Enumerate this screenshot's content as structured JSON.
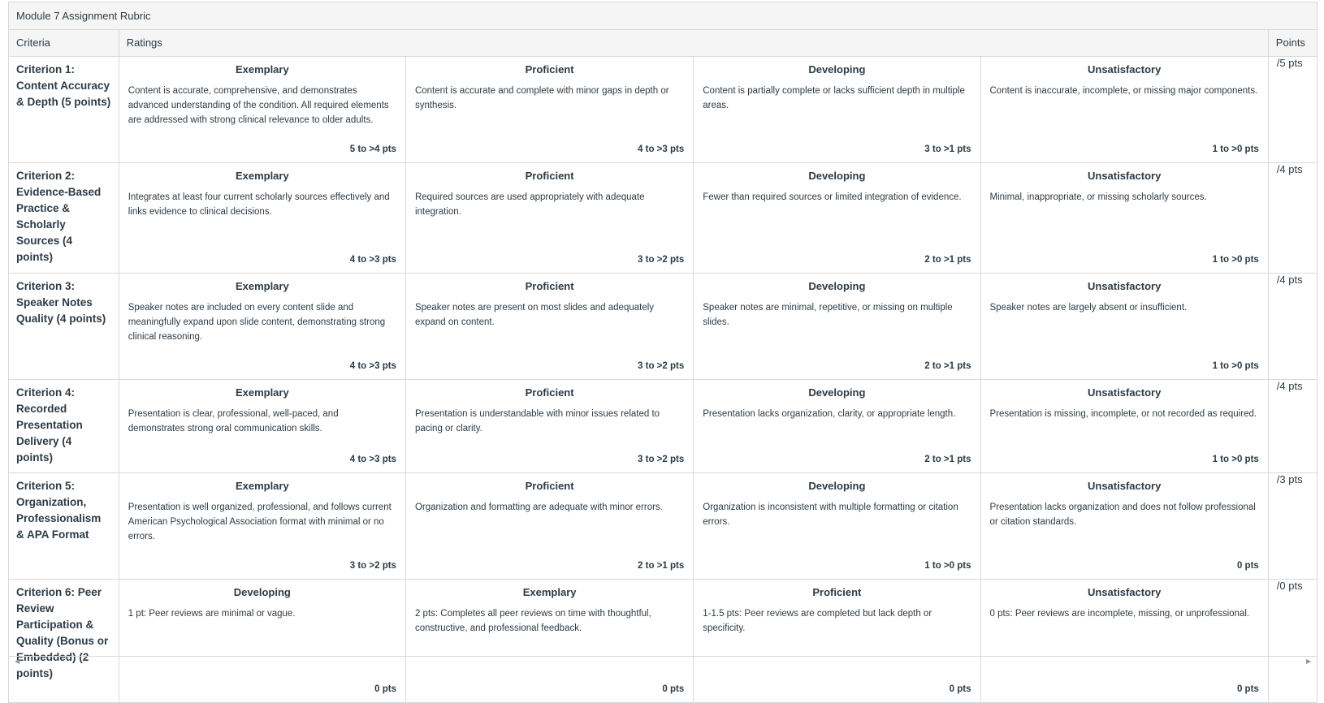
{
  "title": "Module 7 Assignment Rubric",
  "headers": {
    "criteria": "Criteria",
    "ratings": "Ratings",
    "points": "Points"
  },
  "rows": [
    {
      "criterion": "Criterion 1: Content Accuracy & Depth (5 points)",
      "ratings": [
        {
          "title": "Exemplary",
          "desc": "Content is accurate, comprehensive, and demonstrates advanced understanding of the condition. All required elements are addressed with strong clinical relevance to older adults.",
          "pts": "5 to >4 pts"
        },
        {
          "title": "Proficient",
          "desc": "Content is accurate and complete with minor gaps in depth or synthesis.",
          "pts": "4 to >3 pts"
        },
        {
          "title": "Developing",
          "desc": "Content is partially complete or lacks sufficient depth in multiple areas.",
          "pts": "3 to >1 pts"
        },
        {
          "title": "Unsatisfactory",
          "desc": "Content is inaccurate, incomplete, or missing major components.",
          "pts": "1 to >0 pts"
        }
      ],
      "points": "/5 pts"
    },
    {
      "criterion": "Criterion 2: Evidence-Based Practice & Scholarly Sources (4 points)",
      "ratings": [
        {
          "title": "Exemplary",
          "desc": "Integrates at least four current scholarly sources effectively and links evidence to clinical decisions.",
          "pts": "4 to >3 pts"
        },
        {
          "title": "Proficient",
          "desc": "Required sources are used appropriately with adequate integration.",
          "pts": "3 to >2 pts"
        },
        {
          "title": "Developing",
          "desc": "Fewer than required sources or limited integration of evidence.",
          "pts": "2 to >1 pts"
        },
        {
          "title": "Unsatisfactory",
          "desc": "Minimal, inappropriate, or missing scholarly sources.",
          "pts": "1 to >0 pts"
        }
      ],
      "points": "/4 pts"
    },
    {
      "criterion": "Criterion 3: Speaker Notes Quality (4 points)",
      "ratings": [
        {
          "title": "Exemplary",
          "desc": "Speaker notes are included on every content slide and meaningfully expand upon slide content, demonstrating strong clinical reasoning.",
          "pts": "4 to >3 pts"
        },
        {
          "title": "Proficient",
          "desc": "Speaker notes are present on most slides and adequately expand on content.",
          "pts": "3 to >2 pts"
        },
        {
          "title": "Developing",
          "desc": "Speaker notes are minimal, repetitive, or missing on multiple slides.",
          "pts": "2 to >1 pts"
        },
        {
          "title": "Unsatisfactory",
          "desc": "Speaker notes are largely absent or insufficient.",
          "pts": "1 to >0 pts"
        }
      ],
      "points": "/4 pts"
    },
    {
      "criterion": "Criterion 4: Recorded Presentation Delivery (4 points)",
      "ratings": [
        {
          "title": "Exemplary",
          "desc": "Presentation is clear, professional, well-paced, and demonstrates strong oral communication skills.",
          "pts": "4 to >3 pts"
        },
        {
          "title": "Proficient",
          "desc": "Presentation is understandable with minor issues related to pacing or clarity.",
          "pts": "3 to >2 pts"
        },
        {
          "title": "Developing",
          "desc": "Presentation lacks organization, clarity, or appropriate length.",
          "pts": "2 to >1 pts"
        },
        {
          "title": "Unsatisfactory",
          "desc": "Presentation is missing, incomplete, or not recorded as required.",
          "pts": "1 to >0 pts"
        }
      ],
      "points": "/4 pts"
    },
    {
      "criterion": "Criterion 5: Organization, Professionalism & APA Format",
      "ratings": [
        {
          "title": "Exemplary",
          "desc": "Presentation is well organized, professional, and follows current American Psychological Association format with minimal or no errors.",
          "pts": "3 to >2 pts"
        },
        {
          "title": "Proficient",
          "desc": "Organization and formatting are adequate with minor errors.",
          "pts": "2 to >1 pts"
        },
        {
          "title": "Developing",
          "desc": "Organization is inconsistent with multiple formatting or citation errors.",
          "pts": "1 to >0 pts"
        },
        {
          "title": "Unsatisfactory",
          "desc": "Presentation lacks organization and does not follow professional or citation standards.",
          "pts": "0 pts"
        }
      ],
      "points": "/3 pts"
    },
    {
      "criterion": "Criterion 6: Peer Review Participation & Quality (Bonus or Embedded) (2 points)",
      "ratings": [
        {
          "title": "Developing",
          "desc": "1 pt: Peer reviews are minimal or vague.",
          "pts": "0 pts"
        },
        {
          "title": "Exemplary",
          "desc": "2 pts: Completes all peer reviews on time with thoughtful, constructive, and professional feedback.",
          "pts": "0 pts"
        },
        {
          "title": "Proficient",
          "desc": "1-1.5 pts: Peer reviews are completed but lack depth or specificity.",
          "pts": "0 pts"
        },
        {
          "title": "Unsatisfactory",
          "desc": "0 pts: Peer reviews are incomplete, missing, or unprofessional.",
          "pts": "0 pts"
        }
      ],
      "points": "/0 pts"
    }
  ],
  "scroll": {
    "left_icon": "arrow-left-icon",
    "right_icon": "arrow-right-icon"
  }
}
